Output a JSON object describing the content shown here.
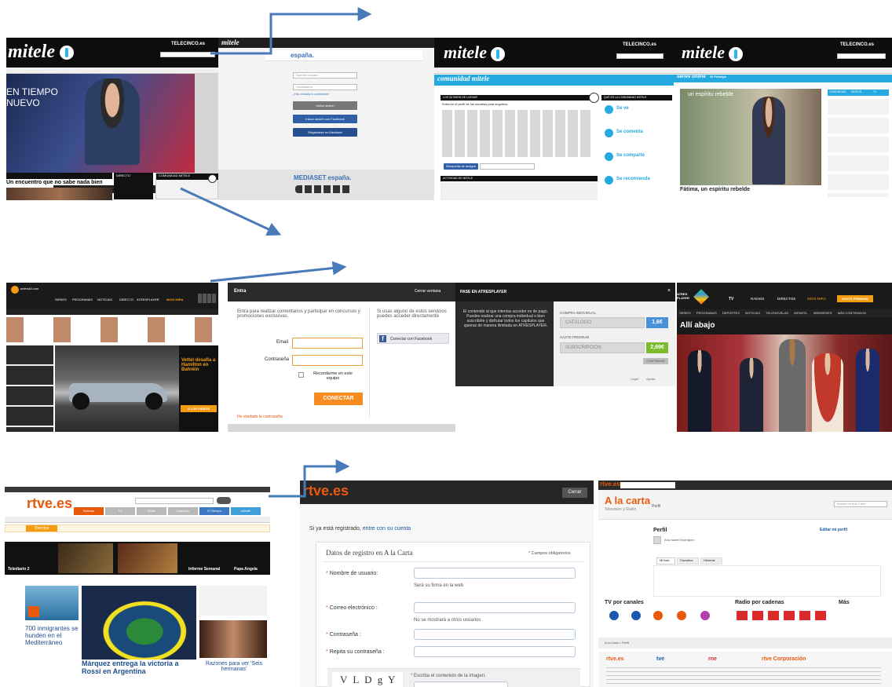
{
  "row1": {
    "mitele_home": {
      "logo": "mitele",
      "telecinco": "TELECINCO.es",
      "hero_line1": "EN TIEMPO",
      "hero_line2": "NUEVO",
      "strip_title": "Un encuentro que no sabe nada bien",
      "widget_left": "DIRECTO",
      "widget_right": "COMUNIDAD MITELE"
    },
    "login": {
      "brand": "mitele",
      "mediaset": "españa.",
      "field_user": "Nombre usuario",
      "field_pass": "Contraseña",
      "forgot": "¿Has olvidado tu contraseña?",
      "btn_login": "Iniciar sesión",
      "btn_facebook": "Iniciar sesión con Facebook",
      "btn_register": "Registrarse en Mediaset",
      "footer_brand": "MEDIASET españa."
    },
    "community": {
      "logo": "mitele",
      "telecinco": "TELECINCO.es",
      "bar_title": "comunidad mitele",
      "section_left": "LOS ÚLTIMOS DE LLEGAR",
      "section_intro": "Entra en el perfil de los usuarios para seguirlos",
      "section_right": "QUÉ ES LA COMUNIDAD MITELE",
      "feature_1": "Se ve",
      "feature_2": "Se comenta",
      "feature_3": "Se comparte",
      "feature_4": "Se recomienda",
      "activity": "ACTIVIDAD DE MITELE",
      "search_btn": "Búsqueda de amigos"
    },
    "series": {
      "logo": "mitele",
      "telecinco": "TELECINCO.es",
      "bar_title": "series online",
      "subbar": "El Príncipe",
      "video_caption": "un espíritu rebelde",
      "title": "Fátima, un espíritu rebelde",
      "tabs": [
        "COMUNIDAD",
        "VIDEOS",
        "TV"
      ]
    }
  },
  "row2": {
    "atres_home": {
      "site": "antena3.com",
      "nav": [
        "SERIES",
        "PROGRAMAS",
        "NOTICIAS",
        "DIRECTO",
        "ATRESPLAYER",
        "MIOS MIRA"
      ],
      "headline_1": "Vettel desafía a Hamilton en Bahréin",
      "cta": "A LOS VIDEOS"
    },
    "login": {
      "header": "Entra",
      "close": "Cerrar ventana",
      "intro": "Entra para realizar comentarios y participar en concursos y promociones exclusivas.",
      "email_label": "Email",
      "password_label": "Contraseña",
      "remember": "Recordarme en este equipo",
      "connect": "CONECTAR",
      "forgot": "He olvidado la contraseña",
      "social_intro": "Si usas alguno de estos servicios puedes acceder directamente",
      "facebook": "Conectar con Facebook"
    },
    "premium": {
      "header": "PASE EN ATRESPLAYER",
      "message": "El contenido al que intentas acceder es de pago. Puedes realizar una compra individual o bien suscribirte y disfrutar todos los capítulos que quieras de manera ilimitada en ATRESPLAYER.",
      "buy_label": "COMPRA INDIVIDUAL",
      "catalog": "CATÁLOGO",
      "price_1": "1,6€",
      "premium_label": "HAZTE PREMIUM",
      "subscription": "SUBSCRIPCIÓN",
      "price_2": "2,69€",
      "continue": "CONTINUAR",
      "footer_1": "Legal",
      "footer_2": "Ayuda"
    },
    "atres_video": {
      "logo": "ATRES PLAYER",
      "nav": [
        "TV",
        "RADIOS",
        "DIRECTOS",
        "MIOS MIRA",
        "HAZTE PREMIUM"
      ],
      "subnav": [
        "SERIES",
        "PROGRAMAS",
        "DEPORTES",
        "NOTICIAS",
        "TELENOVELAS",
        "INFANTIL",
        "WEBSERIES",
        "MÁS CONTENIDOS"
      ],
      "title": "Allí abajo"
    }
  },
  "row3": {
    "rtve_home": {
      "logo": "rtve.es",
      "tabs": [
        "Noticias",
        "TV",
        "Radio",
        "Deportes",
        "El Tiempo",
        "Infantil"
      ],
      "top_alert": "Directos",
      "story_1": "Telediario 2",
      "story_2": "Informe Semanal",
      "story_3": "Papa Angela",
      "sidebar_lead": "700 inmigrantes se hunden en el Mediterráneo",
      "main_headline": "Márquez entrega la victoria a Rossi en Argentina",
      "side_headline": "Razones para ver 'Seis hermanas'"
    },
    "rtve_register": {
      "logo": "rtve.es",
      "close": "Cerrar",
      "registered": "Si ya está registrado,",
      "registered_link": "entre con su cuenta",
      "form_title": "Datos de registro en A la Carta",
      "required": "* Campos obligatorios",
      "user_label": "Nombre de usuario:",
      "user_hint": "Será su firma en la web",
      "email_label": "Correo electrónico :",
      "email_hint": "No se mostrará a otros usuarios",
      "pass_label": "Contraseña :",
      "repeat_label": "Repita su contraseña :",
      "captcha": "V L D g Y n",
      "captcha_label": "Escriba el contenido de la imagen:"
    },
    "rtve_profile": {
      "logo": "rtve.es",
      "section": "A la carta",
      "subtitle": "Televisión y Radio",
      "profile_label": "Perfil",
      "user_name": "Ana Isabel Rodríguez",
      "edit_profile": "Editar mi perfil",
      "search": "Buscar en A la Carta",
      "tabs": [
        "Mi lista",
        "Favoritos",
        "Historial"
      ],
      "tv_title": "TV por canales",
      "radio_title": "Radio por cadenas",
      "more": "Más",
      "breadcrumb": "A la Carta > Perfil",
      "footer_brands": [
        "rtve.es",
        "tve",
        "rne",
        "rtve Corporación"
      ]
    }
  },
  "colors": {
    "mitele_cyan": "#24a9e1",
    "facebook_blue": "#2f5fa7",
    "atres_orange": "#f39c12",
    "rtve_orange": "#e8590c",
    "arrow_blue": "#4a7ab8"
  }
}
